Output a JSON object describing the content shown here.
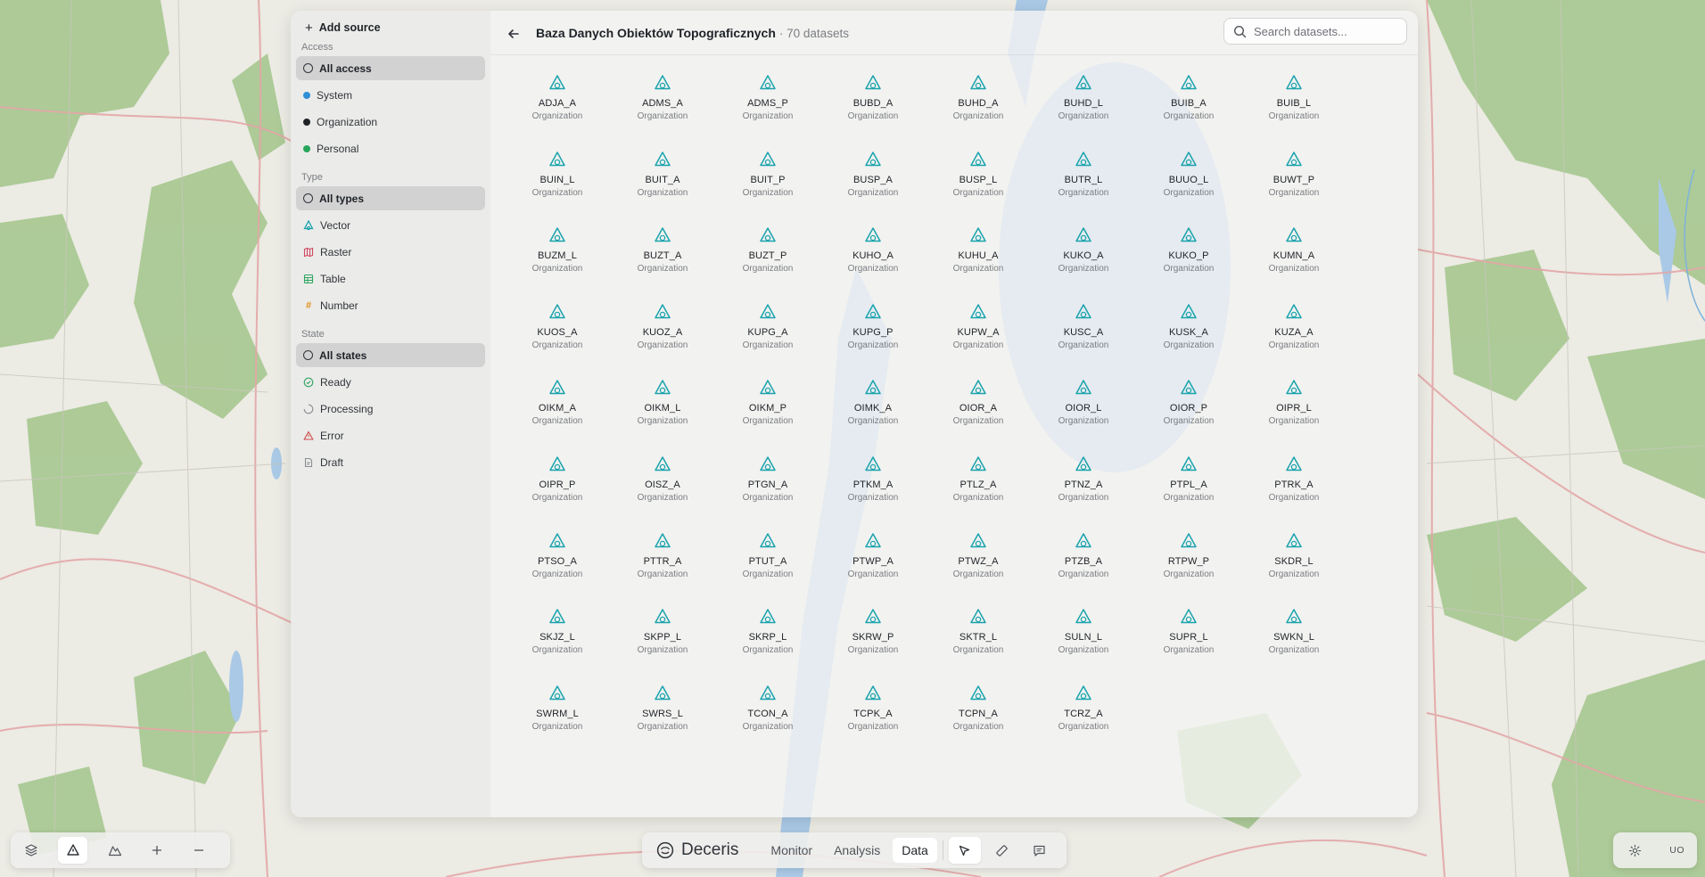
{
  "sidebar": {
    "add_source": "Add source",
    "sections": [
      {
        "title": "Access",
        "items": [
          {
            "label": "All access",
            "icon": "circle-outline-icon",
            "active": true
          },
          {
            "label": "System",
            "icon": "dot-icon",
            "color": "#2f8fd6"
          },
          {
            "label": "Organization",
            "icon": "dot-icon",
            "color": "#1f2328"
          },
          {
            "label": "Personal",
            "icon": "dot-icon",
            "color": "#26a65b"
          }
        ]
      },
      {
        "title": "Type",
        "items": [
          {
            "label": "All types",
            "icon": "circle-outline-icon",
            "active": true
          },
          {
            "label": "Vector",
            "icon": "vector-icon",
            "color": "#1aa3ad"
          },
          {
            "label": "Raster",
            "icon": "raster-icon",
            "color": "#d04a62"
          },
          {
            "label": "Table",
            "icon": "table-icon",
            "color": "#2ea462"
          },
          {
            "label": "Number",
            "icon": "hash-icon",
            "color": "#e2941c"
          }
        ]
      },
      {
        "title": "State",
        "items": [
          {
            "label": "All states",
            "icon": "circle-outline-icon",
            "active": true
          },
          {
            "label": "Ready",
            "icon": "check-circle-icon",
            "color": "#2ea462"
          },
          {
            "label": "Processing",
            "icon": "spinner-icon",
            "color": "#8a8d92"
          },
          {
            "label": "Error",
            "icon": "warning-triangle-icon",
            "color": "#d04a4a"
          },
          {
            "label": "Draft",
            "icon": "draft-icon",
            "color": "#8a8d92"
          }
        ]
      }
    ]
  },
  "header": {
    "title": "Baza Danych Obiektów Topograficznych",
    "count": "· 70 datasets",
    "search_placeholder": "Search datasets..."
  },
  "datasets": [
    {
      "name": "ADJA_A",
      "owner": "Organization"
    },
    {
      "name": "ADMS_A",
      "owner": "Organization"
    },
    {
      "name": "ADMS_P",
      "owner": "Organization"
    },
    {
      "name": "BUBD_A",
      "owner": "Organization"
    },
    {
      "name": "BUHD_A",
      "owner": "Organization"
    },
    {
      "name": "BUHD_L",
      "owner": "Organization"
    },
    {
      "name": "BUIB_A",
      "owner": "Organization"
    },
    {
      "name": "BUIB_L",
      "owner": "Organization"
    },
    {
      "name": "BUIN_L",
      "owner": "Organization"
    },
    {
      "name": "BUIT_A",
      "owner": "Organization"
    },
    {
      "name": "BUIT_P",
      "owner": "Organization"
    },
    {
      "name": "BUSP_A",
      "owner": "Organization"
    },
    {
      "name": "BUSP_L",
      "owner": "Organization"
    },
    {
      "name": "BUTR_L",
      "owner": "Organization"
    },
    {
      "name": "BUUO_L",
      "owner": "Organization"
    },
    {
      "name": "BUWT_P",
      "owner": "Organization"
    },
    {
      "name": "BUZM_L",
      "owner": "Organization"
    },
    {
      "name": "BUZT_A",
      "owner": "Organization"
    },
    {
      "name": "BUZT_P",
      "owner": "Organization"
    },
    {
      "name": "KUHO_A",
      "owner": "Organization"
    },
    {
      "name": "KUHU_A",
      "owner": "Organization"
    },
    {
      "name": "KUKO_A",
      "owner": "Organization"
    },
    {
      "name": "KUKO_P",
      "owner": "Organization"
    },
    {
      "name": "KUMN_A",
      "owner": "Organization"
    },
    {
      "name": "KUOS_A",
      "owner": "Organization"
    },
    {
      "name": "KUOZ_A",
      "owner": "Organization"
    },
    {
      "name": "KUPG_A",
      "owner": "Organization"
    },
    {
      "name": "KUPG_P",
      "owner": "Organization"
    },
    {
      "name": "KUPW_A",
      "owner": "Organization"
    },
    {
      "name": "KUSC_A",
      "owner": "Organization"
    },
    {
      "name": "KUSK_A",
      "owner": "Organization"
    },
    {
      "name": "KUZA_A",
      "owner": "Organization"
    },
    {
      "name": "OIKM_A",
      "owner": "Organization"
    },
    {
      "name": "OIKM_L",
      "owner": "Organization"
    },
    {
      "name": "OIKM_P",
      "owner": "Organization"
    },
    {
      "name": "OIMK_A",
      "owner": "Organization"
    },
    {
      "name": "OIOR_A",
      "owner": "Organization"
    },
    {
      "name": "OIOR_L",
      "owner": "Organization"
    },
    {
      "name": "OIOR_P",
      "owner": "Organization"
    },
    {
      "name": "OIPR_L",
      "owner": "Organization"
    },
    {
      "name": "OIPR_P",
      "owner": "Organization"
    },
    {
      "name": "OISZ_A",
      "owner": "Organization"
    },
    {
      "name": "PTGN_A",
      "owner": "Organization"
    },
    {
      "name": "PTKM_A",
      "owner": "Organization"
    },
    {
      "name": "PTLZ_A",
      "owner": "Organization"
    },
    {
      "name": "PTNZ_A",
      "owner": "Organization"
    },
    {
      "name": "PTPL_A",
      "owner": "Organization"
    },
    {
      "name": "PTRK_A",
      "owner": "Organization"
    },
    {
      "name": "PTSO_A",
      "owner": "Organization"
    },
    {
      "name": "PTTR_A",
      "owner": "Organization"
    },
    {
      "name": "PTUT_A",
      "owner": "Organization"
    },
    {
      "name": "PTWP_A",
      "owner": "Organization"
    },
    {
      "name": "PTWZ_A",
      "owner": "Organization"
    },
    {
      "name": "PTZB_A",
      "owner": "Organization"
    },
    {
      "name": "RTPW_P",
      "owner": "Organization"
    },
    {
      "name": "SKDR_L",
      "owner": "Organization"
    },
    {
      "name": "SKJZ_L",
      "owner": "Organization"
    },
    {
      "name": "SKPP_L",
      "owner": "Organization"
    },
    {
      "name": "SKRP_L",
      "owner": "Organization"
    },
    {
      "name": "SKRW_P",
      "owner": "Organization"
    },
    {
      "name": "SKTR_L",
      "owner": "Organization"
    },
    {
      "name": "SULN_L",
      "owner": "Organization"
    },
    {
      "name": "SUPR_L",
      "owner": "Organization"
    },
    {
      "name": "SWKN_L",
      "owner": "Organization"
    },
    {
      "name": "SWRM_L",
      "owner": "Organization"
    },
    {
      "name": "SWRS_L",
      "owner": "Organization"
    },
    {
      "name": "TCON_A",
      "owner": "Organization"
    },
    {
      "name": "TCPK_A",
      "owner": "Organization"
    },
    {
      "name": "TCPN_A",
      "owner": "Organization"
    },
    {
      "name": "TCRZ_A",
      "owner": "Organization"
    }
  ],
  "dataset_icon": "vector-shapes-icon",
  "accent_color": "#4b44d6",
  "vector_color": "#1aa3ad",
  "bottom_left_tools": [
    "layers-icon",
    "vector-shapes-icon",
    "area-chart-icon",
    "zoom-in-icon",
    "zoom-out-icon"
  ],
  "bottom_center": {
    "brand": "Deceris",
    "tabs": [
      {
        "label": "Monitor",
        "active": false
      },
      {
        "label": "Analysis",
        "active": false
      },
      {
        "label": "Data",
        "active": true
      }
    ],
    "tools": [
      "pointer-icon",
      "ruler-icon",
      "comment-icon"
    ]
  },
  "bottom_right": {
    "settings_icon": "gear-icon",
    "avatar": "UO"
  }
}
